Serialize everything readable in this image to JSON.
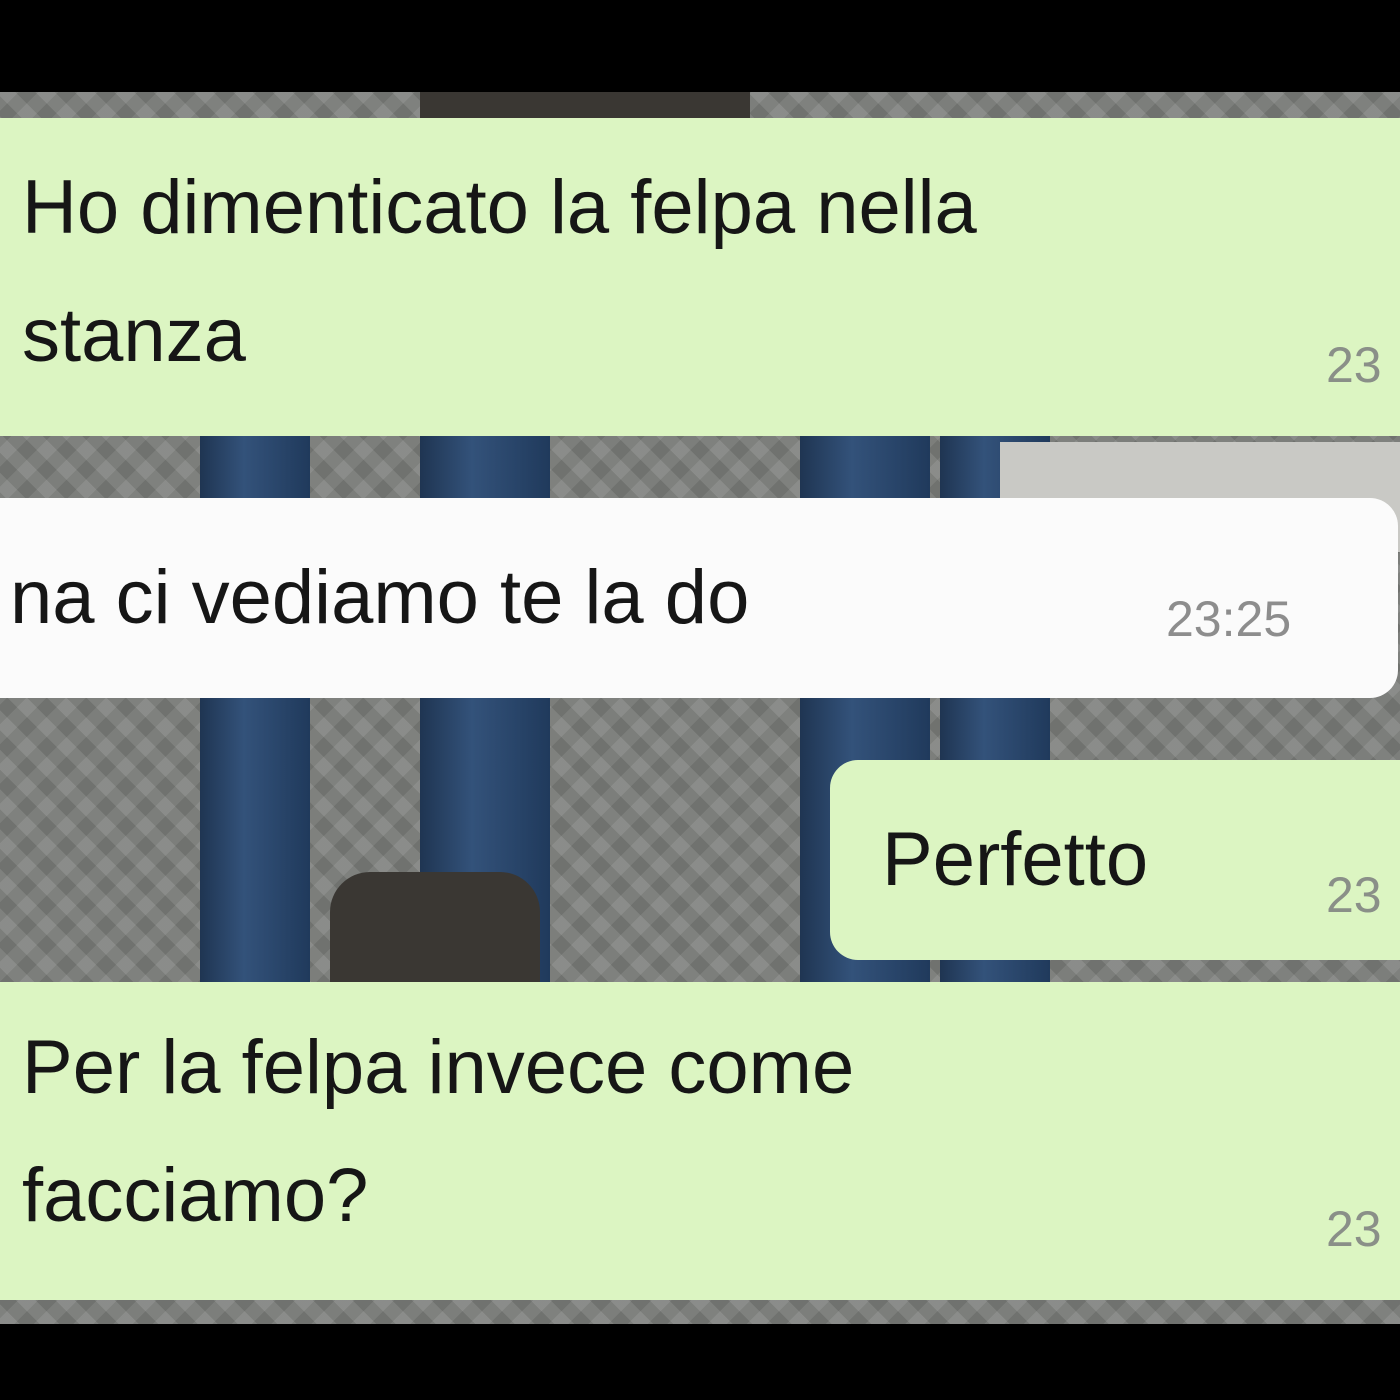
{
  "chat": {
    "messages": [
      {
        "direction": "outgoing",
        "lines": [
          "Ho dimenticato la felpa nella",
          "stanza"
        ],
        "time": "23"
      },
      {
        "direction": "incoming",
        "lines": [
          "na ci vediamo te la do"
        ],
        "time": "23:25"
      },
      {
        "direction": "outgoing",
        "lines": [
          "Perfetto"
        ],
        "time": "23"
      },
      {
        "direction": "outgoing",
        "lines": [
          "Per la felpa invece come",
          "facciamo?"
        ],
        "time": "23"
      }
    ]
  },
  "colors": {
    "outgoing_bubble": "#dcf5c2",
    "incoming_bubble": "#fbfbfb",
    "text": "#161616",
    "timestamp": "#8a8f88",
    "frame": "#000000"
  }
}
